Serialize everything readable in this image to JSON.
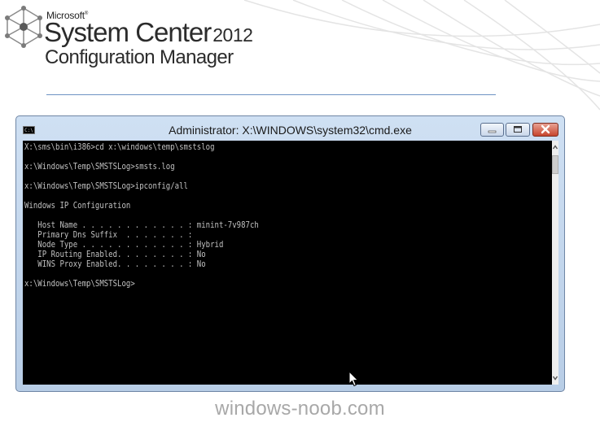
{
  "branding": {
    "company": "Microsoft",
    "trademark": "®",
    "product": "System Center",
    "year": "2012",
    "subtitle": "Configuration Manager",
    "icon": "system-center-logo-icon"
  },
  "window": {
    "title": "Administrator: X:\\WINDOWS\\system32\\cmd.exe",
    "icon": "cmd-icon",
    "icon_text": "C:\\",
    "controls": [
      "minimize-icon",
      "maximize-icon",
      "close-icon"
    ]
  },
  "console": {
    "lines": [
      "X:\\sms\\bin\\i386>cd x:\\windows\\temp\\smstslog",
      "",
      "x:\\Windows\\Temp\\SMSTSLog>smsts.log",
      "",
      "x:\\Windows\\Temp\\SMSTSLog>ipconfig/all",
      "",
      "Windows IP Configuration",
      "",
      "   Host Name . . . . . . . . . . . . : minint-7v987ch",
      "   Primary Dns Suffix  . . . . . . . :",
      "   Node Type . . . . . . . . . . . . : Hybrid",
      "   IP Routing Enabled. . . . . . . . : No",
      "   WINS Proxy Enabled. . . . . . . . : No",
      "",
      "x:\\Windows\\Temp\\SMSTSLog>"
    ]
  },
  "footer": {
    "text": "windows-noob.com"
  },
  "colors": {
    "console_bg": "#000000",
    "console_fg": "#c0c0c0",
    "title_bar": "#cfe0f3",
    "brand_rule": "#6e93c4",
    "close_button": "#c7452e"
  }
}
